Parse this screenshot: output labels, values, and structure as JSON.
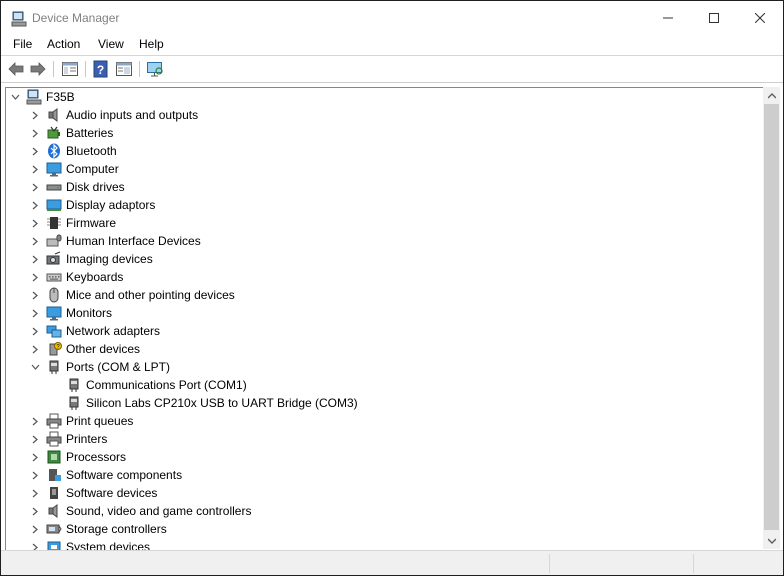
{
  "window": {
    "title": "Device Manager"
  },
  "menu": {
    "file": "File",
    "action": "Action",
    "view": "View",
    "help": "Help"
  },
  "toolbar": {
    "icons": [
      "back-arrow-icon",
      "forward-arrow-icon",
      "properties-panel-icon",
      "help-icon",
      "update-driver-icon",
      "scan-hardware-icon"
    ]
  },
  "tree": {
    "root": "F35B",
    "categories": [
      {
        "label": "Audio inputs and outputs",
        "icon": "speaker-icon"
      },
      {
        "label": "Batteries",
        "icon": "battery-icon"
      },
      {
        "label": "Bluetooth",
        "icon": "bluetooth-icon"
      },
      {
        "label": "Computer",
        "icon": "monitor-icon"
      },
      {
        "label": "Disk drives",
        "icon": "disk-drive-icon"
      },
      {
        "label": "Display adaptors",
        "icon": "display-adapter-icon"
      },
      {
        "label": "Firmware",
        "icon": "chip-icon"
      },
      {
        "label": "Human Interface Devices",
        "icon": "hid-icon"
      },
      {
        "label": "Imaging devices",
        "icon": "camera-icon"
      },
      {
        "label": "Keyboards",
        "icon": "keyboard-icon"
      },
      {
        "label": "Mice and other pointing devices",
        "icon": "mouse-icon"
      },
      {
        "label": "Monitors",
        "icon": "monitor-icon"
      },
      {
        "label": "Network adapters",
        "icon": "network-icon"
      },
      {
        "label": "Other devices",
        "icon": "unknown-device-icon"
      },
      {
        "label": "Ports (COM & LPT)",
        "icon": "port-icon",
        "expanded": true,
        "children": [
          "Communications Port (COM1)",
          "Silicon Labs CP210x USB to UART Bridge (COM3)"
        ]
      },
      {
        "label": "Print queues",
        "icon": "printer-icon"
      },
      {
        "label": "Printers",
        "icon": "printer-icon"
      },
      {
        "label": "Processors",
        "icon": "processor-icon"
      },
      {
        "label": "Software components",
        "icon": "software-component-icon"
      },
      {
        "label": "Software devices",
        "icon": "software-device-icon"
      },
      {
        "label": "Sound, video and game controllers",
        "icon": "speaker-icon"
      },
      {
        "label": "Storage controllers",
        "icon": "storage-controller-icon"
      },
      {
        "label": "System devices",
        "icon": "system-device-icon"
      }
    ]
  },
  "colors": {
    "accent": "#0078d7",
    "tree_line": "#828790",
    "scrollbar": "#f0f0f0"
  }
}
